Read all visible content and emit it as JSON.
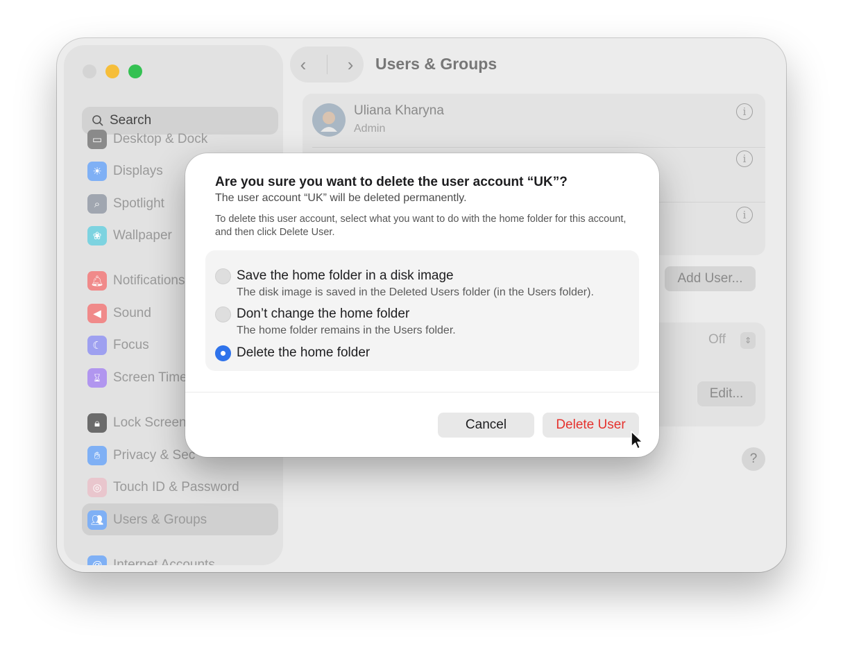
{
  "window": {
    "title": "Users & Groups",
    "search_placeholder": "Search"
  },
  "sidebar": {
    "items": [
      {
        "label": "Desktop & Dock",
        "icon": "dock-icon",
        "color": "#6e6e6e"
      },
      {
        "label": "Displays",
        "icon": "sun-icon",
        "color": "#3b82f6"
      },
      {
        "label": "Spotlight",
        "icon": "magnifier-icon",
        "color": "#6b7280"
      },
      {
        "label": "Wallpaper",
        "icon": "flower-icon",
        "color": "#22b8cf"
      },
      {
        "label": "Notifications",
        "icon": "bell-icon",
        "color": "#ef4444"
      },
      {
        "label": "Sound",
        "icon": "speaker-icon",
        "color": "#ef4444"
      },
      {
        "label": "Focus",
        "icon": "moon-icon",
        "color": "#6366f1"
      },
      {
        "label": "Screen Time",
        "icon": "hourglass-icon",
        "color": "#7c3aed"
      },
      {
        "label": "Lock Screen",
        "icon": "lock-icon",
        "color": "#1f2937"
      },
      {
        "label": "Privacy & Sec",
        "icon": "hand-icon",
        "color": "#3b82f6"
      },
      {
        "label": "Touch ID & Password",
        "icon": "fingerprint-icon",
        "color": "#f9a8b8"
      },
      {
        "label": "Users & Groups",
        "icon": "users-icon",
        "color": "#3b82f6"
      },
      {
        "label": "Internet Accounts",
        "icon": "at-icon",
        "color": "#3b82f6"
      }
    ]
  },
  "main": {
    "users": [
      {
        "name": "Uliana Kharyna",
        "role": "Admin"
      },
      {
        "name": "",
        "role": ""
      },
      {
        "name": "",
        "role": ""
      }
    ],
    "add_user_label": "Add User...",
    "auto_login_value": "Off",
    "edit_label": "Edit...",
    "help_label": "?"
  },
  "dialog": {
    "title": "Are you sure you want to delete the user account “UK”?",
    "subtitle": "The user account “UK” will be deleted permanently.",
    "description": "To delete this user account, select what you want to do with the home folder for this account, and then click Delete User.",
    "options": [
      {
        "label": "Save the home folder in a disk image",
        "help": "The disk image is saved in the Deleted Users folder (in the Users folder).",
        "selected": false
      },
      {
        "label": "Don’t change the home folder",
        "help": "The home folder remains in the Users folder.",
        "selected": false
      },
      {
        "label": "Delete the home folder",
        "help": "",
        "selected": true
      }
    ],
    "cancel_label": "Cancel",
    "delete_label": "Delete User",
    "delete_color": "#e5322d",
    "accent": "#2f73eb"
  }
}
